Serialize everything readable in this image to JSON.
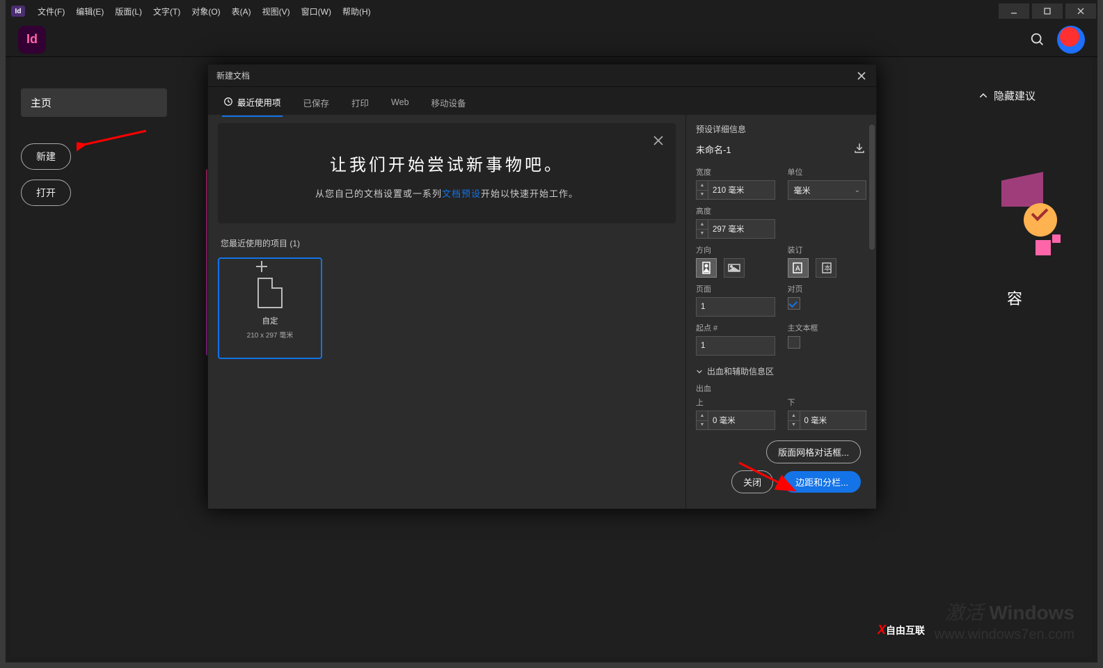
{
  "menubar": {
    "items": [
      "文件(F)",
      "编辑(E)",
      "版面(L)",
      "文字(T)",
      "对象(O)",
      "表(A)",
      "视图(V)",
      "窗口(W)",
      "帮助(H)"
    ]
  },
  "appLogo": "Id",
  "sidebar": {
    "home": "主页",
    "newBtn": "新建",
    "openBtn": "打开"
  },
  "suggestions": {
    "toggle": "隐藏建议"
  },
  "rightStub": {
    "text": "容"
  },
  "dialog": {
    "title": "新建文档",
    "tabs": [
      "最近使用项",
      "已保存",
      "打印",
      "Web",
      "移动设备"
    ],
    "banner": {
      "heading": "让我们开始尝试新事物吧。",
      "textPre": "从您自己的文档设置或一系列",
      "link": "文档预设",
      "textPost": "开始以快速开始工作。"
    },
    "recentLabel": "您最近使用的项目 (1)",
    "preset": {
      "title": "自定",
      "subtitle": "210 x 297 毫米"
    },
    "details": {
      "sectionTitle": "预设详细信息",
      "name": "未命名-1",
      "widthLabel": "宽度",
      "widthValue": "210 毫米",
      "unitLabel": "单位",
      "unitValue": "毫米",
      "heightLabel": "高度",
      "heightValue": "297 毫米",
      "orientationLabel": "方向",
      "bindingLabel": "装订",
      "pagesLabel": "页面",
      "pagesValue": "1",
      "facingLabel": "对页",
      "startLabel": "起点 #",
      "startValue": "1",
      "primaryFrameLabel": "主文本框",
      "bleedSection": "出血和辅助信息区",
      "bleedLabel": "出血",
      "topLabel": "上",
      "bottomLabel": "下",
      "bleedTop": "0 毫米",
      "bleedBottom": "0 毫米"
    },
    "buttons": {
      "layoutGrid": "版面网格对话框...",
      "close": "关闭",
      "margins": "边距和分栏..."
    }
  },
  "watermarks": {
    "w1a": "激活 ",
    "w1b": "Windows",
    "w2": "www.windows7en.com",
    "w3": "自由互联"
  }
}
